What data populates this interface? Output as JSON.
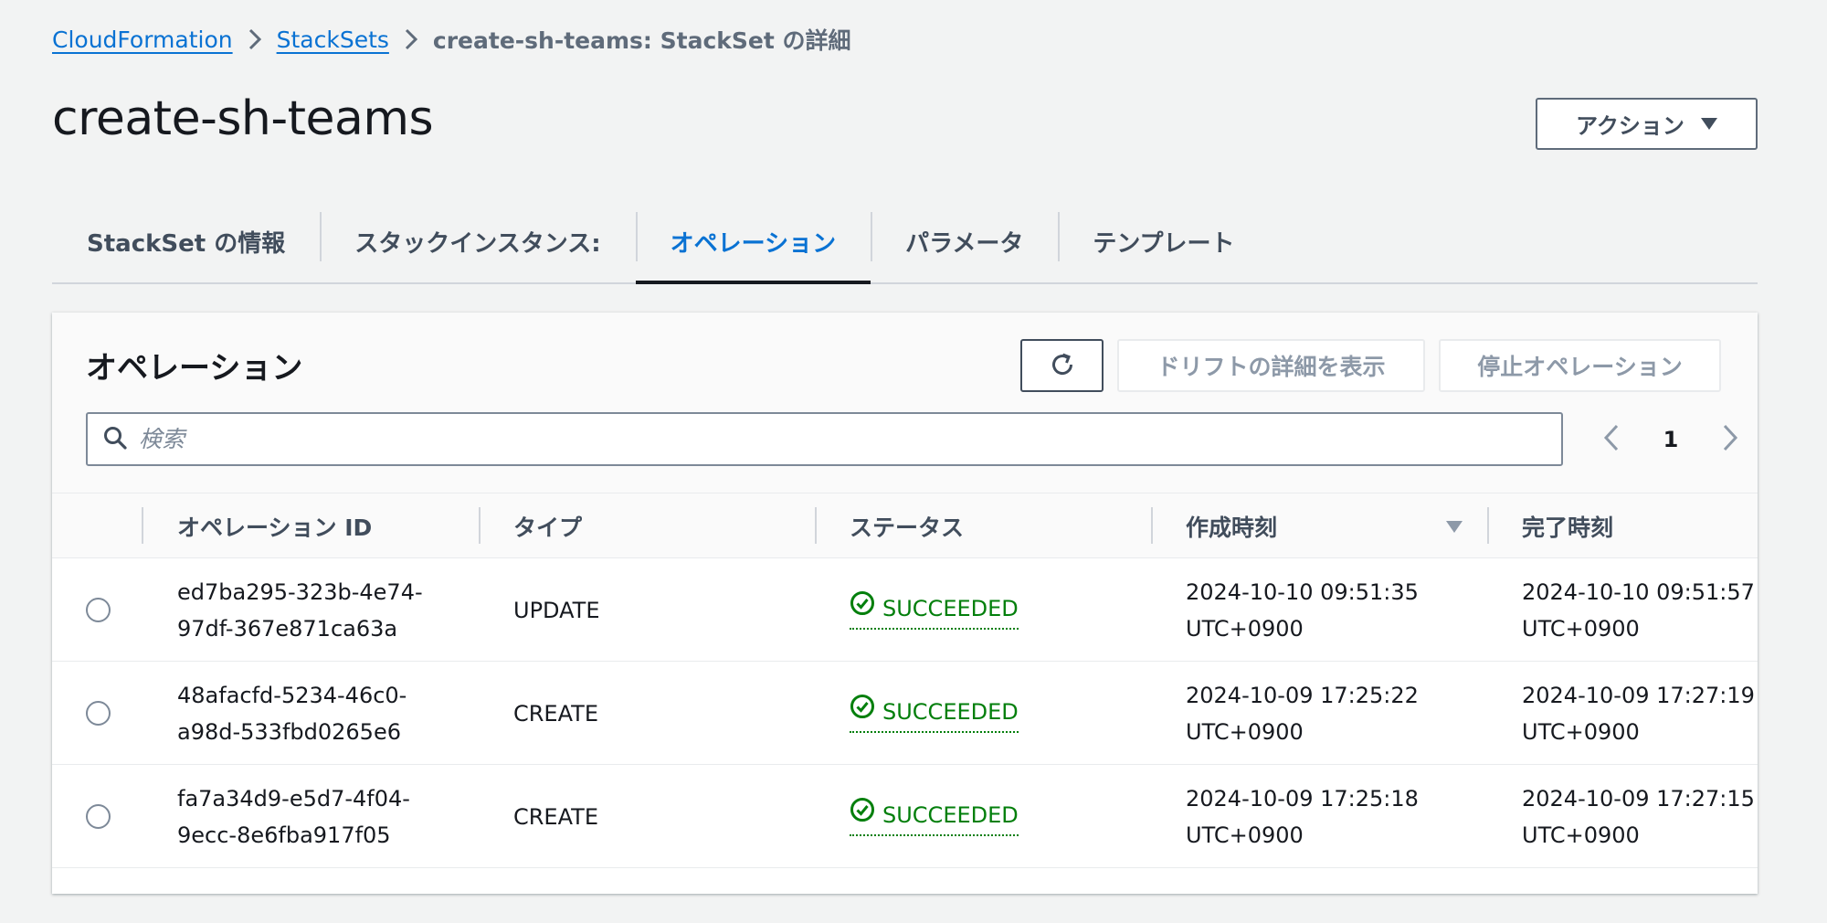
{
  "breadcrumb": {
    "items": [
      "CloudFormation",
      "StackSets"
    ],
    "current": "create-sh-teams: StackSet の詳細"
  },
  "page": {
    "title": "create-sh-teams",
    "actions_label": "アクション"
  },
  "tabs": [
    {
      "label": "StackSet の情報"
    },
    {
      "label": "スタックインスタンス:"
    },
    {
      "label": "オペレーション"
    },
    {
      "label": "パラメータ"
    },
    {
      "label": "テンプレート"
    }
  ],
  "active_tab": "オペレーション",
  "panel": {
    "title": "オペレーション",
    "drift_button": "ドリフトの詳細を表示",
    "stop_button": "停止オペレーション",
    "search_placeholder": "検索",
    "page": "1"
  },
  "table": {
    "columns": [
      "オペレーション ID",
      "タイプ",
      "ステータス",
      "作成時刻",
      "完了時刻"
    ],
    "rows": [
      {
        "id_line1": "ed7ba295-323b-4e74-",
        "id_line2": "97df-367e871ca63a",
        "type": "UPDATE",
        "status": "SUCCEEDED",
        "created_line1": "2024-10-10 09:51:35",
        "created_line2": "UTC+0900",
        "completed_line1": "2024-10-10 09:51:57",
        "completed_line2": "UTC+0900"
      },
      {
        "id_line1": "48afacfd-5234-46c0-",
        "id_line2": "a98d-533fbd0265e6",
        "type": "CREATE",
        "status": "SUCCEEDED",
        "created_line1": "2024-10-09 17:25:22",
        "created_line2": "UTC+0900",
        "completed_line1": "2024-10-09 17:27:19",
        "completed_line2": "UTC+0900"
      },
      {
        "id_line1": "fa7a34d9-e5d7-4f04-",
        "id_line2": "9ecc-8e6fba917f05",
        "type": "CREATE",
        "status": "SUCCEEDED",
        "created_line1": "2024-10-09 17:25:18",
        "created_line2": "UTC+0900",
        "completed_line1": "2024-10-09 17:27:15",
        "completed_line2": "UTC+0900"
      }
    ]
  },
  "colors": {
    "link": "#0972d3",
    "success": "#037f0c",
    "text": "#16191f",
    "background": "#f2f3f3"
  },
  "icons": {
    "breadcrumb_separator": "chevron-right-icon",
    "actions_caret": "caret-down-icon",
    "refresh": "refresh-icon",
    "search": "search-icon",
    "pager_prev": "chevron-left-icon",
    "pager_next": "chevron-right-icon",
    "sort": "sort-descending-icon",
    "status": "check-circle-icon"
  }
}
